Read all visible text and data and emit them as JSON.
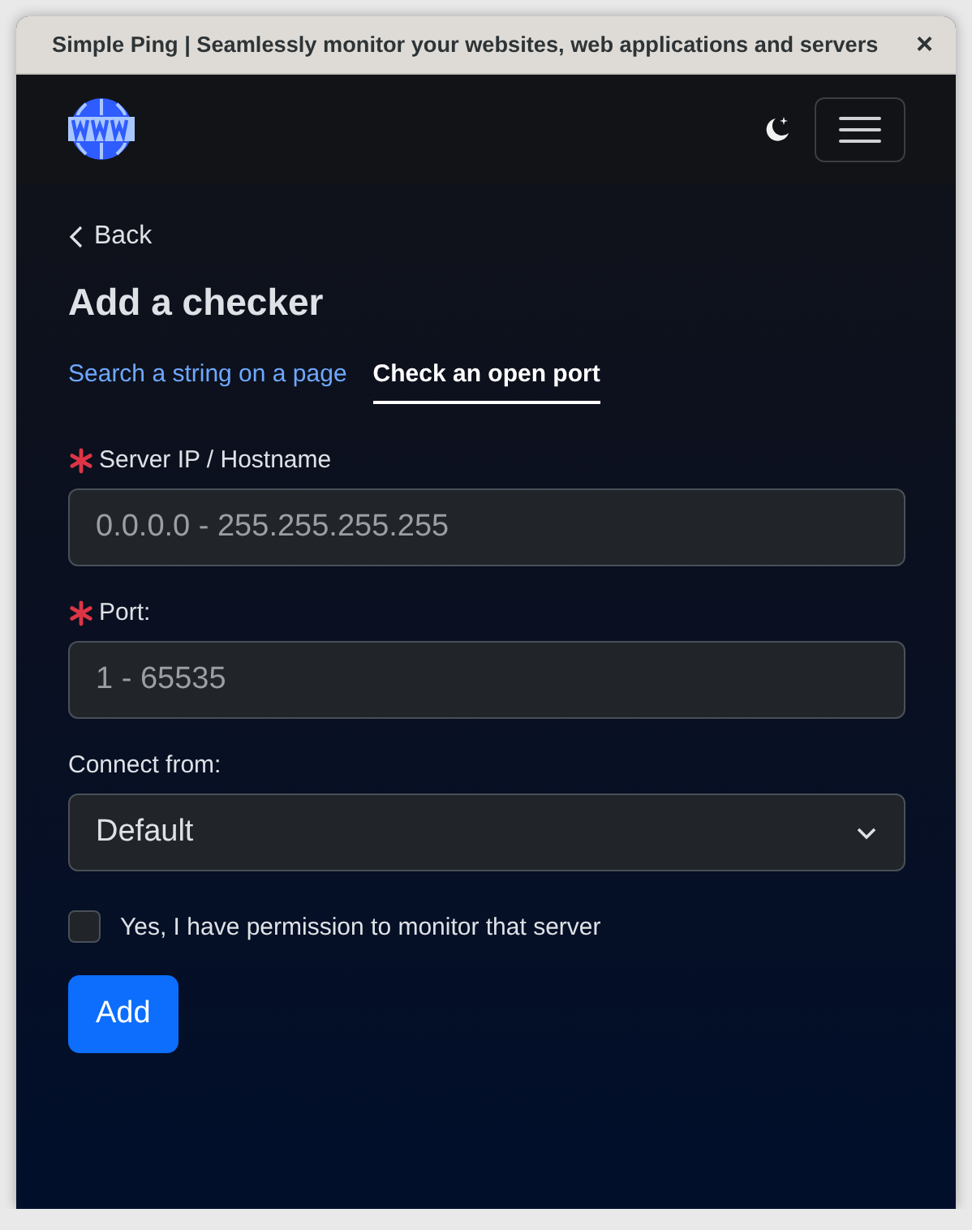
{
  "window": {
    "title": "Simple Ping | Seamlessly monitor your websites, web applications and servers",
    "close": "×"
  },
  "back": {
    "label": "Back"
  },
  "heading": "Add a checker",
  "tabs": [
    {
      "label": "Search a string on a page",
      "selected": false
    },
    {
      "label": "Check an open port",
      "selected": true
    }
  ],
  "fields": [
    {
      "kind": "input",
      "label": "Server IP / Hostname",
      "required": true,
      "placeholder": "0.0.0.0 - 255.255.255.255"
    },
    {
      "kind": "input",
      "label": "Port:",
      "required": true,
      "placeholder": "1 - 65535"
    },
    {
      "kind": "select",
      "label": "Connect from:",
      "required": false,
      "value": "Default"
    }
  ],
  "consent": {
    "label": "Yes, I have permission to monitor that server",
    "checked": false
  },
  "submit": "Add"
}
